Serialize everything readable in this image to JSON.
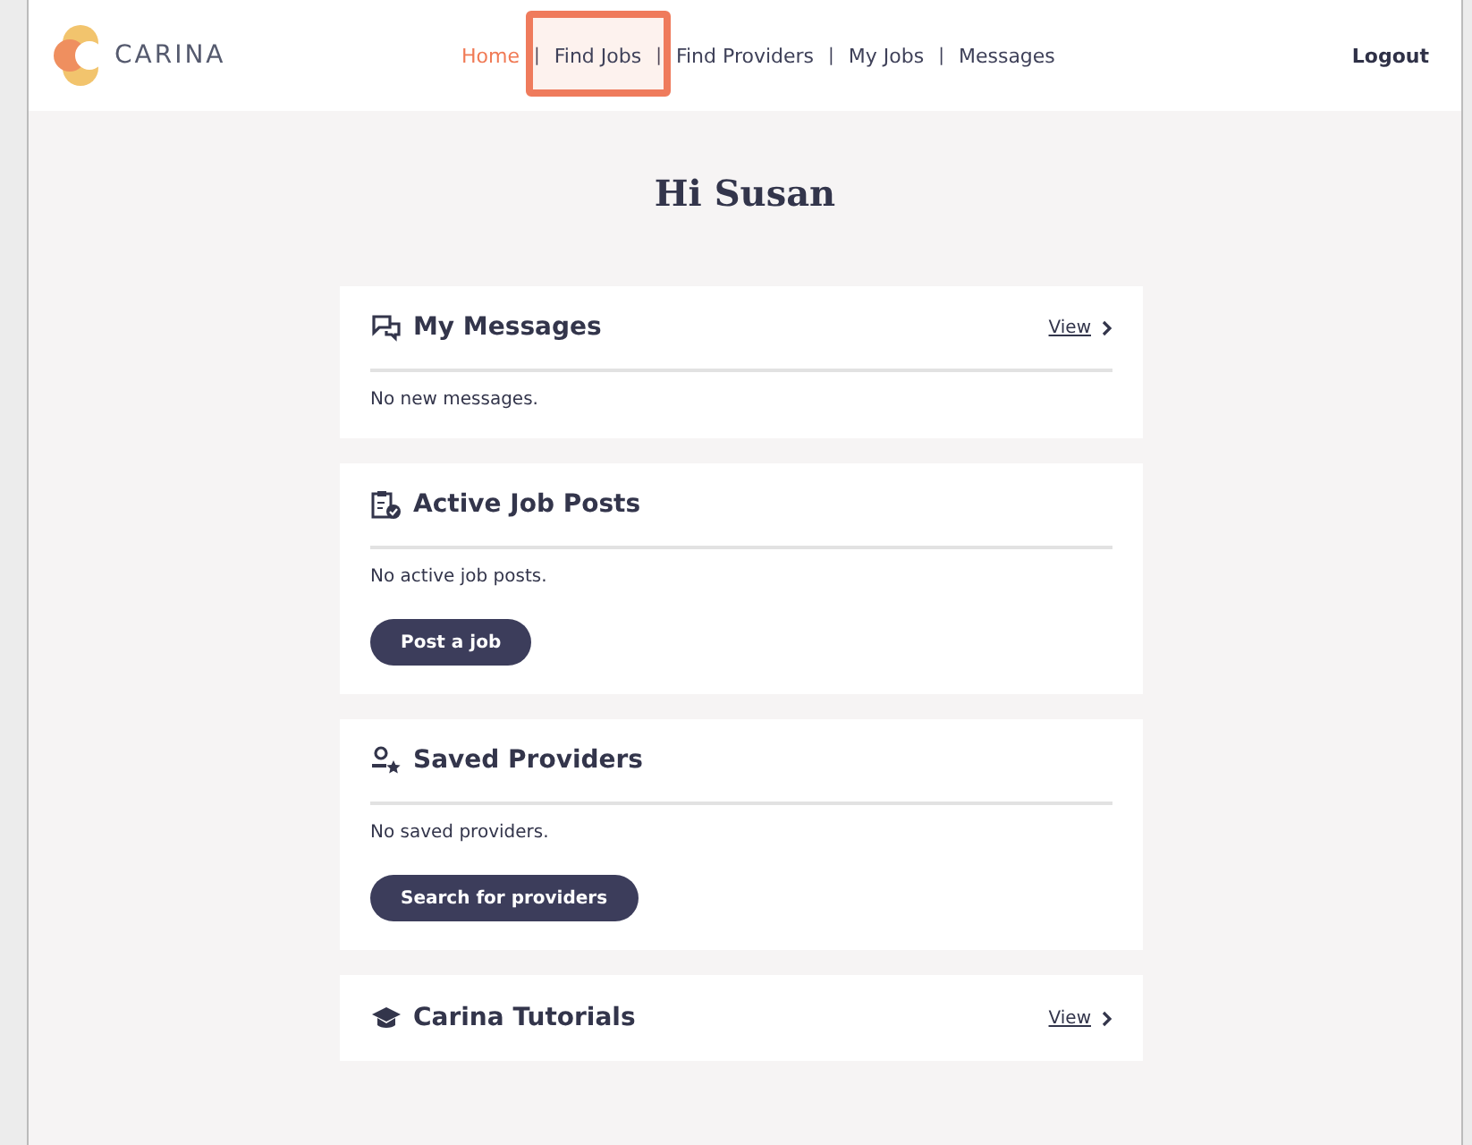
{
  "header": {
    "logo": "CARINA",
    "nav": [
      {
        "label": "Home",
        "selected": true,
        "highlighted": false
      },
      {
        "label": "Find Jobs",
        "selected": false,
        "highlighted": true
      },
      {
        "label": "Find Providers",
        "selected": false,
        "highlighted": false
      },
      {
        "label": "My Jobs",
        "selected": false,
        "highlighted": false
      },
      {
        "label": "Messages",
        "selected": false,
        "highlighted": false
      }
    ],
    "separator": "|",
    "logout": "Logout"
  },
  "greeting": "Hi Susan",
  "cards": [
    {
      "title": "My Messages",
      "link": "View",
      "message": "No new messages."
    },
    {
      "title": "Active Job Posts",
      "message": "No active job posts.",
      "button": "Post a job"
    },
    {
      "title": "Saved Providers",
      "message": "No saved providers.",
      "button": "Search for providers"
    },
    {
      "title": "Carina Tutorials",
      "link": "View"
    }
  ]
}
